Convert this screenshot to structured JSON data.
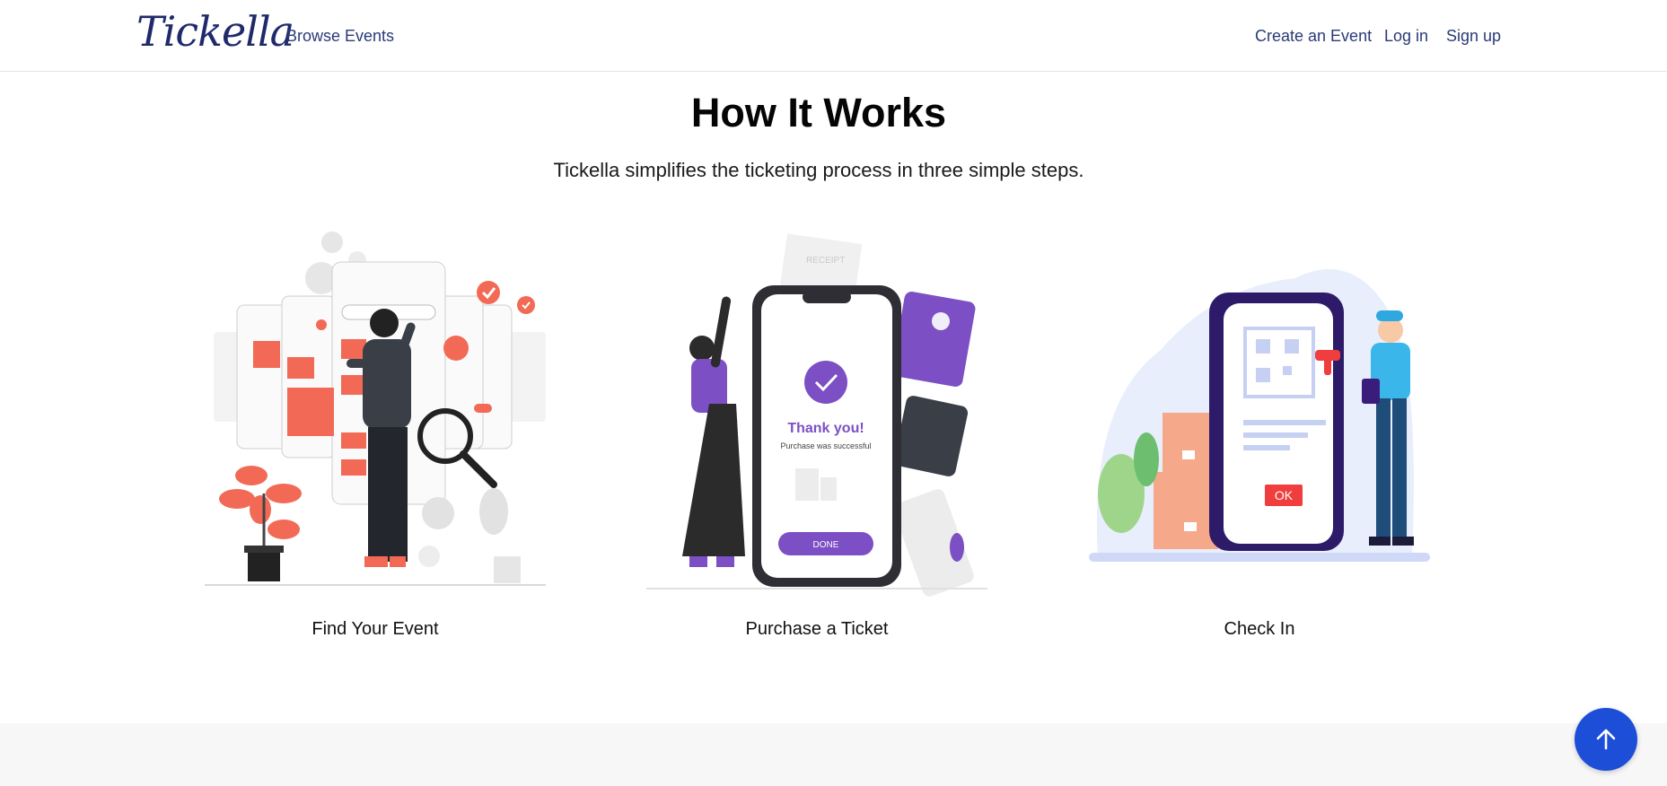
{
  "nav": {
    "logo": "Tickella",
    "browse_events": "Browse Events",
    "create_event": "Create an Event",
    "login": "Log in",
    "signup": "Sign up"
  },
  "hero": {
    "title": "How It Works",
    "subtitle": "Tickella simplifies the ticketing process in three simple steps."
  },
  "steps": [
    {
      "label": "Find Your Event",
      "illustration": "search-events-illustration"
    },
    {
      "label": "Purchase a Ticket",
      "illustration": "purchase-illustration",
      "phone_heading": "Thank you!",
      "phone_text": "Purchase was successful",
      "phone_button": "DONE",
      "receipt_text": "RECEIPT"
    },
    {
      "label": "Check In",
      "illustration": "checkin-illustration",
      "phone_button": "OK"
    }
  ],
  "scroll_top": {
    "icon": "arrow-up-icon"
  },
  "colors": {
    "accent": "#1d4ed8",
    "nav_text": "#2a3a78",
    "coral": "#f26a55",
    "purple": "#7c4fc4",
    "indigo": "#2d1b69"
  }
}
